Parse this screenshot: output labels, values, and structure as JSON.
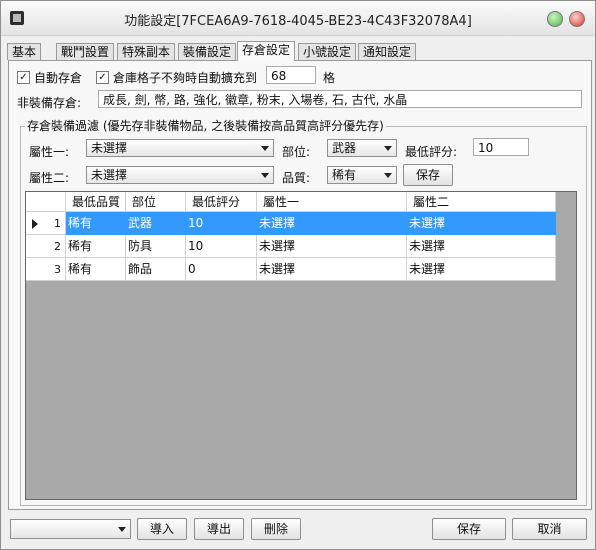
{
  "window": {
    "title": "功能設定[7FCEA6A9-7618-4045-BE23-4C43F32078A4]"
  },
  "tabs": [
    {
      "label": "基本"
    },
    {
      "label": "戰鬥設置"
    },
    {
      "label": "特殊副本"
    },
    {
      "label": "裝備設定"
    },
    {
      "label": "存倉設定"
    },
    {
      "label": "小號設定"
    },
    {
      "label": "通知設定"
    }
  ],
  "options": {
    "auto_store_label": "自動存倉",
    "auto_store_checked": true,
    "auto_expand_label": "倉庫格子不夠時自動擴充到",
    "auto_expand_checked": true,
    "expand_value": "68",
    "expand_unit": "格",
    "non_equip_label": "非裝備存倉:",
    "non_equip_value": "成長, 劍, 幣, 路, 強化, 徽章, 粉末, 入場卷, 石, 古代, 水晶"
  },
  "filter": {
    "group_label": "存倉裝備過濾 (優先存非裝備物品, 之後裝備按高品質高評分優先存)",
    "attr1_label": "屬性一:",
    "attr1_value": "未選擇",
    "attr2_label": "屬性二:",
    "attr2_value": "未選擇",
    "slot_label": "部位:",
    "slot_value": "武器",
    "quality_label": "品質:",
    "quality_value": "稀有",
    "min_score_label": "最低評分:",
    "min_score_value": "10",
    "save_label": "保存"
  },
  "table": {
    "columns": [
      "最低品質",
      "部位",
      "最低評分",
      "屬性一",
      "屬性二"
    ],
    "rows": [
      {
        "index": "1",
        "quality": "稀有",
        "slot": "武器",
        "score": "10",
        "attr1": "未選擇",
        "attr2": "未選擇"
      },
      {
        "index": "2",
        "quality": "稀有",
        "slot": "防具",
        "score": "10",
        "attr1": "未選擇",
        "attr2": "未選擇"
      },
      {
        "index": "3",
        "quality": "稀有",
        "slot": "飾品",
        "score": "0",
        "attr1": "未選擇",
        "attr2": "未選擇"
      }
    ]
  },
  "footer": {
    "profile_value": "",
    "import_label": "導入",
    "export_label": "導出",
    "delete_label": "刪除",
    "save_label": "保存",
    "cancel_label": "取消"
  }
}
